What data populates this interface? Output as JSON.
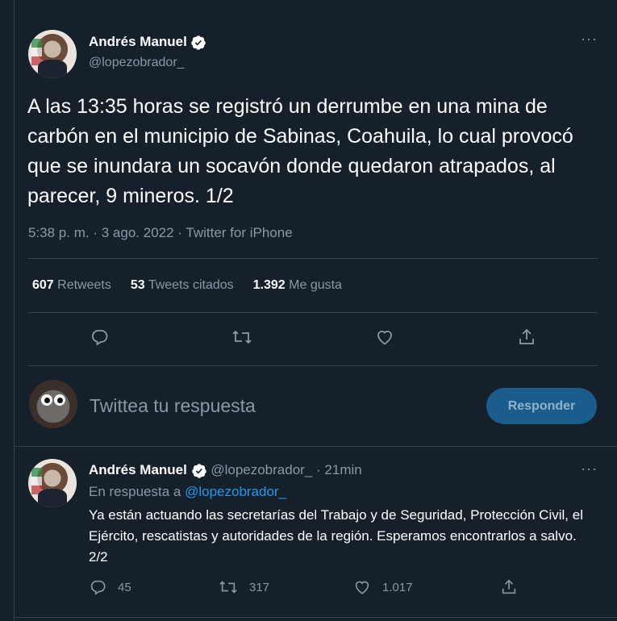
{
  "main_tweet": {
    "author_name": "Andrés Manuel",
    "author_handle": "@lopezobrador_",
    "text": "A las 13:35 horas se registró un derrumbe en una mina de carbón en el municipio de Sabinas, Coahuila, lo cual provocó que se inundara un socavón donde quedaron atrapados, al parecer, 9 mineros. 1/2",
    "time": "5:38 p. m.",
    "separator": "·",
    "date": "3 ago. 2022",
    "source": "Twitter for iPhone",
    "stats": {
      "retweets_count": "607",
      "retweets_label": "Retweets",
      "quotes_count": "53",
      "quotes_label": "Tweets citados",
      "likes_count": "1.392",
      "likes_label": "Me gusta"
    }
  },
  "composer": {
    "placeholder": "Twittea tu respuesta",
    "button_label": "Responder"
  },
  "reply_tweet": {
    "author_name": "Andrés Manuel",
    "author_handle": "@lopezobrador_",
    "separator": "·",
    "time_ago": "21min",
    "in_reply_prefix": "En respuesta a",
    "in_reply_handle": "@lopezobrador_",
    "text": "Ya están actuando las secretarías del Trabajo y de Seguridad, Protección Civil, el Ejército, rescatistas y autoridades de la región. Esperamos encontrarlos a salvo. 2/2",
    "reply_count": "45",
    "retweet_count": "317",
    "like_count": "1.017"
  },
  "icons": [
    "verified-icon",
    "more-icon",
    "reply-icon",
    "retweet-icon",
    "like-icon",
    "share-icon"
  ],
  "colors": {
    "background": "#15202b",
    "link": "#1d9bf0",
    "muted": "#8899a6",
    "button": "#1a5d8c"
  }
}
